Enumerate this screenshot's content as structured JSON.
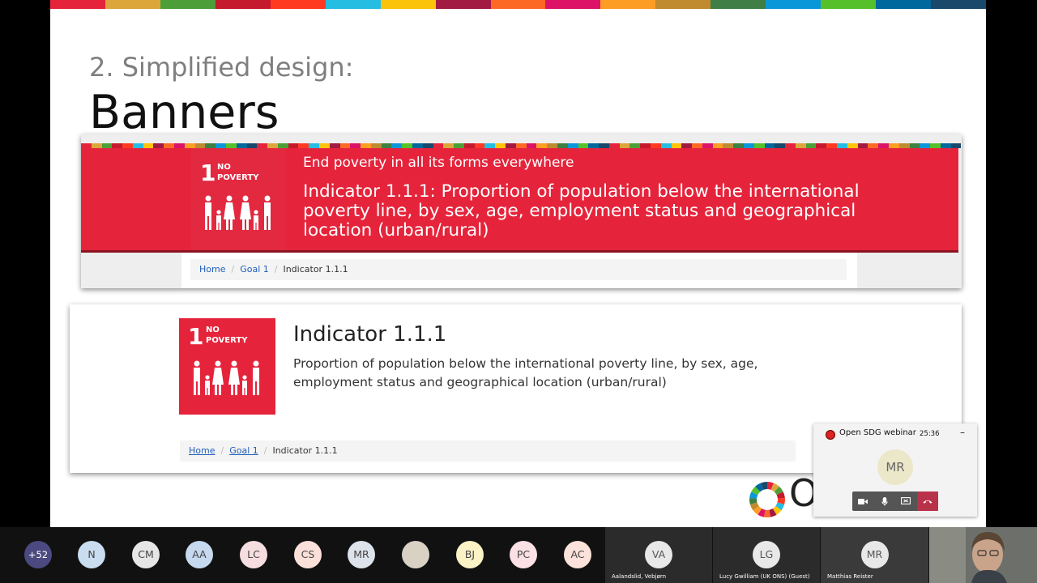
{
  "slide": {
    "subtitle": "2. Simplified design:",
    "title": "Banners",
    "sdg_colors": [
      "#e5243b",
      "#dda63a",
      "#4c9f38",
      "#c5192d",
      "#ff3a21",
      "#26bde2",
      "#fcc30b",
      "#a21942",
      "#fd6925",
      "#dd1367",
      "#fd9d24",
      "#bf8b2e",
      "#3f7e44",
      "#0a97d9",
      "#56c02b",
      "#00689d",
      "#19486a"
    ],
    "banner_a": {
      "goal_number": "1",
      "goal_name_line1": "NO",
      "goal_name_line2": "POVERTY",
      "goal_text": "End poverty in all its forms everywhere",
      "indicator_text": "Indicator 1.1.1: Proportion of population below the international poverty line, by sex, age, employment status and geographical location (urban/rural)",
      "breadcrumb": {
        "home": "Home",
        "goal": "Goal 1",
        "current": "Indicator 1.1.1"
      }
    },
    "banner_b": {
      "goal_number": "1",
      "goal_name_line1": "NO",
      "goal_name_line2": "POVERTY",
      "indicator_title": "Indicator 1.1.1",
      "description": "Proportion of population below the international poverty line, by sex, age, employment status and geographical location (urban/rural)",
      "breadcrumb": {
        "home": "Home",
        "goal": "Goal 1",
        "current": "Indicator 1.1.1"
      }
    },
    "logo_partial_text": "O"
  },
  "meeting_panel": {
    "title": "Open SDG webinar",
    "time": "25:36",
    "minimize_glyph": "–",
    "speaker_initials": "MR",
    "controls": {
      "camera": "camera-icon",
      "mic": "mic-icon",
      "share": "share-screen-icon",
      "end": "end-call-icon"
    }
  },
  "participants_bar": {
    "overflow_count": "+52",
    "circles": [
      {
        "initials": "N",
        "color": "#c9dcf0"
      },
      {
        "initials": "CM",
        "color": "#e6e6e6"
      },
      {
        "initials": "AA",
        "color": "#c6d9ef"
      },
      {
        "initials": "LC",
        "color": "#f5dde0"
      },
      {
        "initials": "CS",
        "color": "#fbe0da"
      },
      {
        "initials": "MR",
        "color": "#dde3ea"
      },
      {
        "initials": "",
        "color": "#d9d2c4"
      },
      {
        "initials": "BJ",
        "color": "#fbf2c6"
      },
      {
        "initials": "PC",
        "color": "#fbe0e6"
      },
      {
        "initials": "AC",
        "color": "#fbe2da"
      }
    ],
    "tiles": [
      {
        "initials": "VA",
        "name": "Aalandslid, Vebjørn"
      },
      {
        "initials": "LG",
        "name": "Lucy Gwilliam (UK ONS) (Guest)"
      },
      {
        "initials": "MR",
        "name": "Matthias Reister"
      }
    ]
  }
}
